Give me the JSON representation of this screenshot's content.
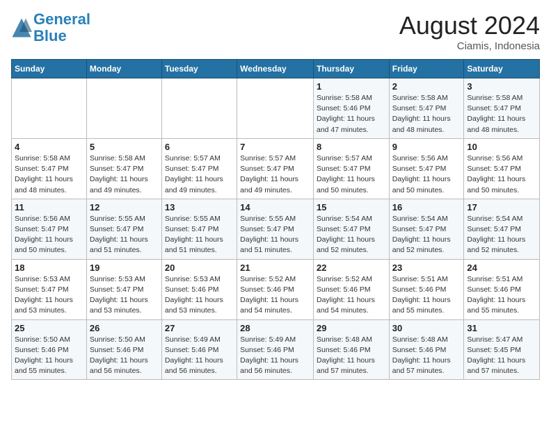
{
  "header": {
    "logo_line1": "General",
    "logo_line2": "Blue",
    "month": "August 2024",
    "location": "Ciamis, Indonesia"
  },
  "weekdays": [
    "Sunday",
    "Monday",
    "Tuesday",
    "Wednesday",
    "Thursday",
    "Friday",
    "Saturday"
  ],
  "weeks": [
    [
      {
        "day": "",
        "info": ""
      },
      {
        "day": "",
        "info": ""
      },
      {
        "day": "",
        "info": ""
      },
      {
        "day": "",
        "info": ""
      },
      {
        "day": "1",
        "info": "Sunrise: 5:58 AM\nSunset: 5:46 PM\nDaylight: 11 hours\nand 47 minutes."
      },
      {
        "day": "2",
        "info": "Sunrise: 5:58 AM\nSunset: 5:47 PM\nDaylight: 11 hours\nand 48 minutes."
      },
      {
        "day": "3",
        "info": "Sunrise: 5:58 AM\nSunset: 5:47 PM\nDaylight: 11 hours\nand 48 minutes."
      }
    ],
    [
      {
        "day": "4",
        "info": "Sunrise: 5:58 AM\nSunset: 5:47 PM\nDaylight: 11 hours\nand 48 minutes."
      },
      {
        "day": "5",
        "info": "Sunrise: 5:58 AM\nSunset: 5:47 PM\nDaylight: 11 hours\nand 49 minutes."
      },
      {
        "day": "6",
        "info": "Sunrise: 5:57 AM\nSunset: 5:47 PM\nDaylight: 11 hours\nand 49 minutes."
      },
      {
        "day": "7",
        "info": "Sunrise: 5:57 AM\nSunset: 5:47 PM\nDaylight: 11 hours\nand 49 minutes."
      },
      {
        "day": "8",
        "info": "Sunrise: 5:57 AM\nSunset: 5:47 PM\nDaylight: 11 hours\nand 50 minutes."
      },
      {
        "day": "9",
        "info": "Sunrise: 5:56 AM\nSunset: 5:47 PM\nDaylight: 11 hours\nand 50 minutes."
      },
      {
        "day": "10",
        "info": "Sunrise: 5:56 AM\nSunset: 5:47 PM\nDaylight: 11 hours\nand 50 minutes."
      }
    ],
    [
      {
        "day": "11",
        "info": "Sunrise: 5:56 AM\nSunset: 5:47 PM\nDaylight: 11 hours\nand 50 minutes."
      },
      {
        "day": "12",
        "info": "Sunrise: 5:55 AM\nSunset: 5:47 PM\nDaylight: 11 hours\nand 51 minutes."
      },
      {
        "day": "13",
        "info": "Sunrise: 5:55 AM\nSunset: 5:47 PM\nDaylight: 11 hours\nand 51 minutes."
      },
      {
        "day": "14",
        "info": "Sunrise: 5:55 AM\nSunset: 5:47 PM\nDaylight: 11 hours\nand 51 minutes."
      },
      {
        "day": "15",
        "info": "Sunrise: 5:54 AM\nSunset: 5:47 PM\nDaylight: 11 hours\nand 52 minutes."
      },
      {
        "day": "16",
        "info": "Sunrise: 5:54 AM\nSunset: 5:47 PM\nDaylight: 11 hours\nand 52 minutes."
      },
      {
        "day": "17",
        "info": "Sunrise: 5:54 AM\nSunset: 5:47 PM\nDaylight: 11 hours\nand 52 minutes."
      }
    ],
    [
      {
        "day": "18",
        "info": "Sunrise: 5:53 AM\nSunset: 5:47 PM\nDaylight: 11 hours\nand 53 minutes."
      },
      {
        "day": "19",
        "info": "Sunrise: 5:53 AM\nSunset: 5:47 PM\nDaylight: 11 hours\nand 53 minutes."
      },
      {
        "day": "20",
        "info": "Sunrise: 5:53 AM\nSunset: 5:46 PM\nDaylight: 11 hours\nand 53 minutes."
      },
      {
        "day": "21",
        "info": "Sunrise: 5:52 AM\nSunset: 5:46 PM\nDaylight: 11 hours\nand 54 minutes."
      },
      {
        "day": "22",
        "info": "Sunrise: 5:52 AM\nSunset: 5:46 PM\nDaylight: 11 hours\nand 54 minutes."
      },
      {
        "day": "23",
        "info": "Sunrise: 5:51 AM\nSunset: 5:46 PM\nDaylight: 11 hours\nand 55 minutes."
      },
      {
        "day": "24",
        "info": "Sunrise: 5:51 AM\nSunset: 5:46 PM\nDaylight: 11 hours\nand 55 minutes."
      }
    ],
    [
      {
        "day": "25",
        "info": "Sunrise: 5:50 AM\nSunset: 5:46 PM\nDaylight: 11 hours\nand 55 minutes."
      },
      {
        "day": "26",
        "info": "Sunrise: 5:50 AM\nSunset: 5:46 PM\nDaylight: 11 hours\nand 56 minutes."
      },
      {
        "day": "27",
        "info": "Sunrise: 5:49 AM\nSunset: 5:46 PM\nDaylight: 11 hours\nand 56 minutes."
      },
      {
        "day": "28",
        "info": "Sunrise: 5:49 AM\nSunset: 5:46 PM\nDaylight: 11 hours\nand 56 minutes."
      },
      {
        "day": "29",
        "info": "Sunrise: 5:48 AM\nSunset: 5:46 PM\nDaylight: 11 hours\nand 57 minutes."
      },
      {
        "day": "30",
        "info": "Sunrise: 5:48 AM\nSunset: 5:46 PM\nDaylight: 11 hours\nand 57 minutes."
      },
      {
        "day": "31",
        "info": "Sunrise: 5:47 AM\nSunset: 5:45 PM\nDaylight: 11 hours\nand 57 minutes."
      }
    ]
  ]
}
